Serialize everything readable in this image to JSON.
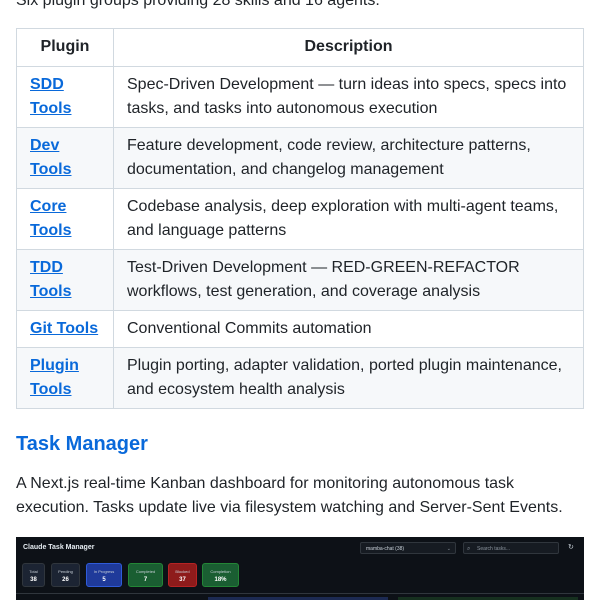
{
  "intro": "Six plugin groups providing 28 skills and 16 agents.",
  "table": {
    "headers": [
      "Plugin",
      "Description"
    ],
    "rows": [
      {
        "name_l1": "SDD",
        "name_l2": "Tools",
        "description": "Spec-Driven Development — turn ideas into specs, specs into tasks, and tasks into autonomous execution"
      },
      {
        "name_l1": "Dev",
        "name_l2": "Tools",
        "description": "Feature development, code review, architecture patterns, documentation, and changelog management"
      },
      {
        "name_l1": "Core",
        "name_l2": "Tools",
        "description": "Codebase analysis, deep exploration with multi-agent teams, and language patterns"
      },
      {
        "name_l1": "TDD",
        "name_l2": "Tools",
        "description": "Test-Driven Development — RED-GREEN-REFACTOR workflows, test generation, and coverage analysis"
      },
      {
        "name_l1": "Git Tools",
        "name_l2": "",
        "description": "Conventional Commits automation"
      },
      {
        "name_l1": "Plugin",
        "name_l2": "Tools",
        "description": "Plugin porting, adapter validation, ported plugin maintenance, and ecosystem health analysis"
      }
    ]
  },
  "section": {
    "title": "Task Manager",
    "description": "A Next.js real-time Kanban dashboard for monitoring autonomous task execution. Tasks update live via filesystem watching and Server-Sent Events."
  },
  "screenshot": {
    "title": "Claude Task Manager",
    "project": "mamba-chat (38)",
    "search_placeholder": "Search tasks...",
    "stats": [
      {
        "label": "Total",
        "value": "38"
      },
      {
        "label": "Pending",
        "value": "26"
      },
      {
        "label": "In Progress",
        "value": "5"
      },
      {
        "label": "Completed",
        "value": "7"
      },
      {
        "label": "Blocked",
        "value": "37"
      },
      {
        "label": "Completion",
        "value": "18%"
      }
    ]
  },
  "colors": {
    "link": "#0969da",
    "border": "#d1d9e0",
    "row_alt": "#f6f8fa",
    "dark_bg": "#0d1117"
  },
  "icons": {
    "chevron": "chevron-down-icon",
    "search": "search-icon",
    "refresh": "refresh-icon"
  }
}
